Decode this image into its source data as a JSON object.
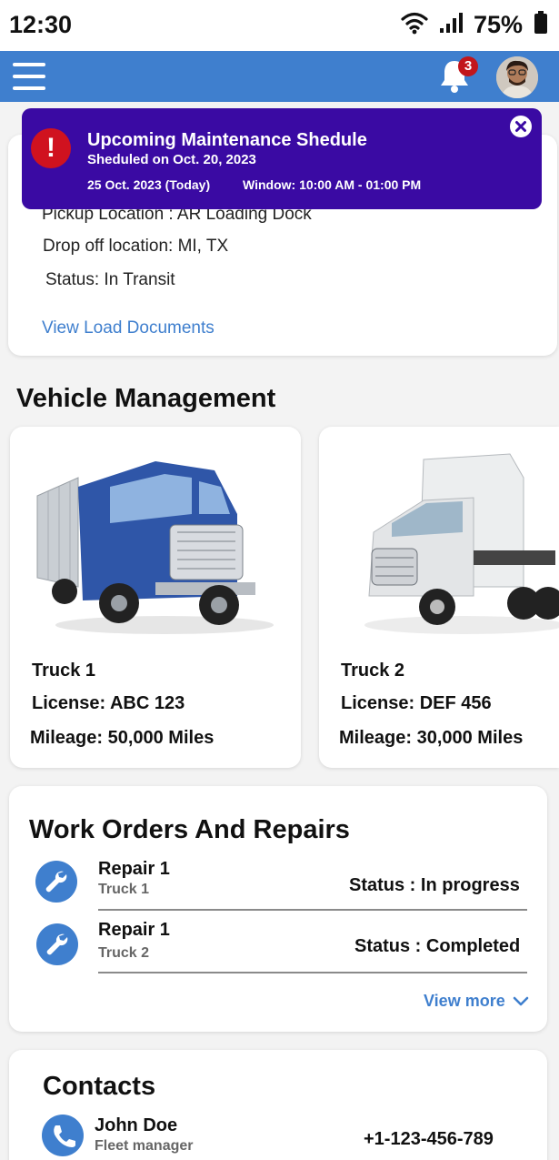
{
  "status_bar": {
    "time": "12:30",
    "battery": "75%"
  },
  "app_bar": {
    "notification_count": "3"
  },
  "banner": {
    "title": "Upcoming Maintenance Shedule",
    "subtitle": "Sheduled on Oct. 20, 2023",
    "date": "25 Oct. 2023 (Today)",
    "window": "Window: 10:00 AM - 01:00 PM"
  },
  "load": {
    "pickup": "Pickup Location : AR Loading Dock",
    "dropoff": "Drop off location: MI, TX",
    "status": "Status: In Transit",
    "documents_link": "View Load Documents"
  },
  "vehicle_management": {
    "title": "Vehicle Management",
    "trucks": [
      {
        "name": "Truck 1",
        "license": "License: ABC 123",
        "mileage": "Mileage: 50,000 Miles",
        "color": "#2f56a8"
      },
      {
        "name": "Truck 2",
        "license": "License: DEF 456",
        "mileage": "Mileage: 30,000 Miles",
        "color": "#e6e8ea"
      }
    ]
  },
  "work_orders": {
    "title": "Work Orders And Repairs",
    "items": [
      {
        "title": "Repair 1",
        "truck": "Truck 1",
        "status": "Status : In progress"
      },
      {
        "title": "Repair 1",
        "truck": "Truck 2",
        "status": "Status : Completed"
      }
    ],
    "view_more": "View more"
  },
  "contacts": {
    "title": "Contacts",
    "items": [
      {
        "name": "John Doe",
        "role": "Fleet manager",
        "phone": "+1-123-456-789"
      }
    ]
  },
  "colors": {
    "primary": "#3f7fce",
    "banner": "#3a0aa3",
    "alert": "#d0121f",
    "badge": "#c2161b"
  },
  "icons": [
    "wifi-icon",
    "signal-icon",
    "battery-icon",
    "menu-icon",
    "bell-icon",
    "alert-icon",
    "close-icon",
    "wrench-icon",
    "chevron-down-icon",
    "phone-icon"
  ]
}
